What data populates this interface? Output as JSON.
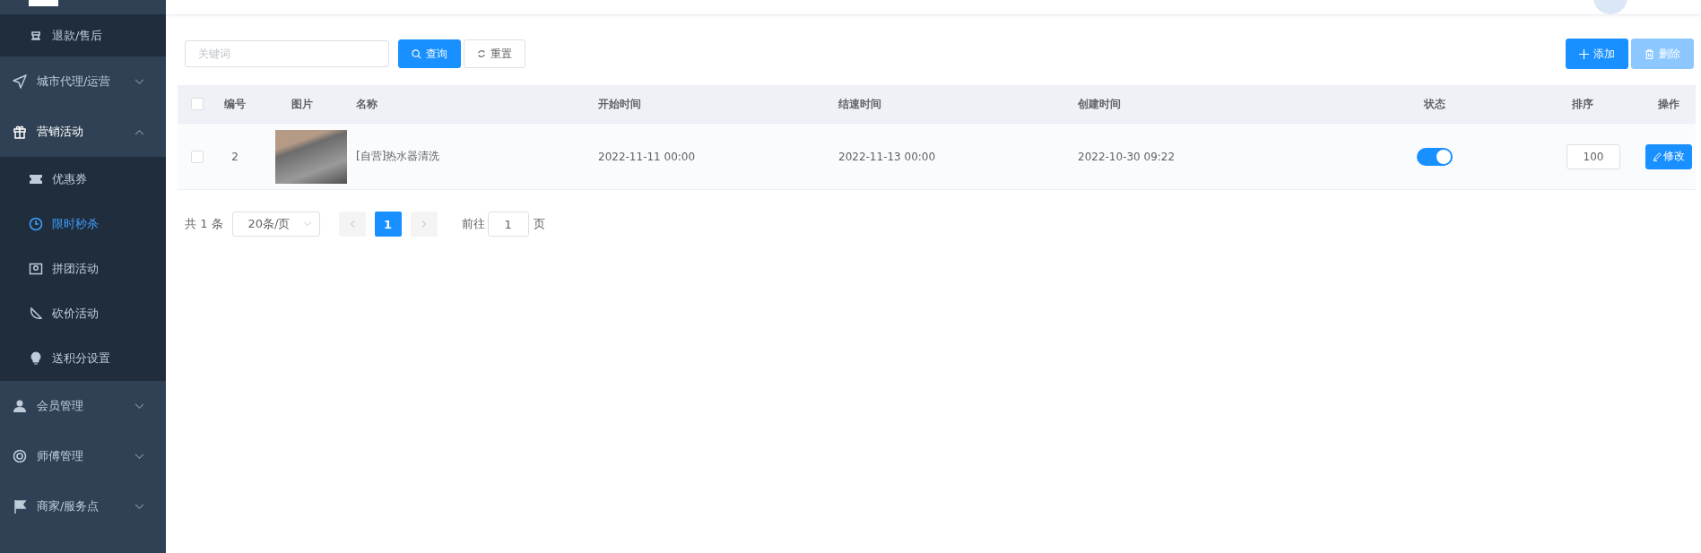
{
  "sidebar": {
    "items": [
      {
        "kind": "sub",
        "label": "退款/售后",
        "selected": false
      },
      {
        "kind": "group",
        "label": "城市代理/运营",
        "expanded": false
      },
      {
        "kind": "group",
        "label": "营销活动",
        "expanded": true,
        "children": [
          {
            "label": "优惠券",
            "selected": false
          },
          {
            "label": "限时秒杀",
            "selected": true
          },
          {
            "label": "拼团活动",
            "selected": false
          },
          {
            "label": "砍价活动",
            "selected": false
          },
          {
            "label": "送积分设置",
            "selected": false
          }
        ]
      },
      {
        "kind": "group",
        "label": "会员管理",
        "expanded": false
      },
      {
        "kind": "group",
        "label": "师傅管理",
        "expanded": false
      },
      {
        "kind": "group",
        "label": "商家/服务点",
        "expanded": false
      }
    ]
  },
  "toolbar": {
    "search": {
      "placeholder": "关键词"
    },
    "query_button": "查询",
    "reset_button": "重置",
    "add_button": "添加",
    "delete_button": {
      "label": "删除",
      "disabled": true
    }
  },
  "table": {
    "all_checked": false,
    "columns": [
      "编号",
      "图片",
      "名称",
      "开始时间",
      "结速时间",
      "创建时间",
      "状态",
      "排序",
      "操作"
    ],
    "rows": [
      {
        "checked": false,
        "id": "2",
        "name": "[自营]热水器清洗",
        "start": "2022-11-11 00:00",
        "end": "2022-11-13 00:00",
        "created": "2022-10-30 09:22",
        "status_on": true,
        "sort": "100",
        "action": "修改"
      }
    ]
  },
  "pagination": {
    "total": "共 1 条",
    "page_size": "20条/页",
    "pages": [
      {
        "label": "1",
        "selected": true
      }
    ],
    "goto_label": "前往",
    "goto_value": "1",
    "goto_suffix": "页"
  }
}
